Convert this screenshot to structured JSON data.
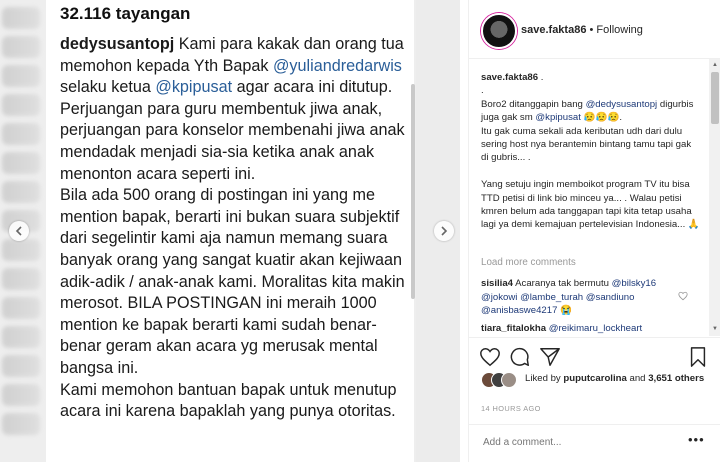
{
  "post": {
    "views": "32.116 tayangan",
    "username": "dedysusantopj",
    "text_1": " Kami para kakak dan orang tua memohon kepada Yth Bapak ",
    "mention_1": "@yuliandredarwis",
    "text_2": " selaku ketua ",
    "mention_2": "@kpipusat",
    "text_3": " agar acara ini ditutup. Perjuangan para guru membentuk jiwa anak, perjuangan para konselor membenahi jiwa anak mendadak menjadi sia-sia ketika anak anak menonton acara seperti ini.",
    "text_4": "Bila ada 500 orang di postingan ini yang me mention bapak, berarti ini bukan suara subjektif dari segelintir kami aja namun memang suara banyak orang yang sangat kuatir akan kejiwaan adik-adik / anak-anak kami. Moralitas kita makin merosot. BILA POSTINGAN ini meraih 1000 mention ke bapak berarti kami sudah benar-benar geram akan acara yg merusak mental bangsa ini.",
    "text_5": "Kami memohon bantuan bapak untuk menutup acara ini karena bapaklah yang punya otoritas.",
    "blur_left": [
      "me",
      "me",
      "@y",
      "ma",
      "kor",
      "me",
      "aca",
      "Bila",
      "me",
      "sub",
      "me",
      "kua",
      "kan",
      "PO",
      "bap",
      "aka",
      "Kar",
      "pu"
    ]
  },
  "header": {
    "username": "save.fakta86",
    "separator": " • ",
    "follow_status": "Following"
  },
  "caption": {
    "username": "save.fakta86",
    "dot1": " .",
    "dot2": ".",
    "p1_a": "Boro2 ditanggapin bang ",
    "p1_m1": "@dedysusantopj",
    "p1_b": " digurbis juga gak sm ",
    "p1_m2": "@kpipusat",
    "p1_emoji": " 😥😥😥.",
    "p1_c": "Itu gak cuma sekali ada keributan udh dari dulu sering host nya berantemin bintang tamu tapi gak di gubris... .",
    "p2": "Yang setuju ingin memboikot program TV itu bisa TTD petisi di link bio minceu ya... . Walau petisi kmren belum ada tanggapan tapi kita tetap usaha lagi ya demi kemajuan pertelevisian Indonesia... 🙏"
  },
  "load_more": "Load more comments",
  "comments": [
    {
      "username": "sisilia4",
      "text": " Acaranya tak bermutu ",
      "mentions": "@bilsky16 @jokowi @lambe_turah @sandiuno @anisbaswe4217",
      "emoji": " 😭"
    },
    {
      "username": "tiara_fitalokha",
      "text": " ",
      "mentions": "@reikimaru_lockheart"
    }
  ],
  "likes": {
    "prefix": "Liked by ",
    "user": "puputcarolina",
    "middle": " and ",
    "count": "3,651 others"
  },
  "timestamp": "14 HOURS AGO",
  "add_comment": {
    "placeholder": "Add a comment..."
  },
  "more_options": "•••",
  "icons": [
    "heart-icon",
    "comment-icon",
    "share-icon",
    "bookmark-icon",
    "chevron-left-icon",
    "chevron-right-icon"
  ],
  "colors": {
    "mention": "#2a5e98",
    "link": "#1e3a78",
    "muted": "#999999",
    "story_ring": "#d6249f"
  }
}
